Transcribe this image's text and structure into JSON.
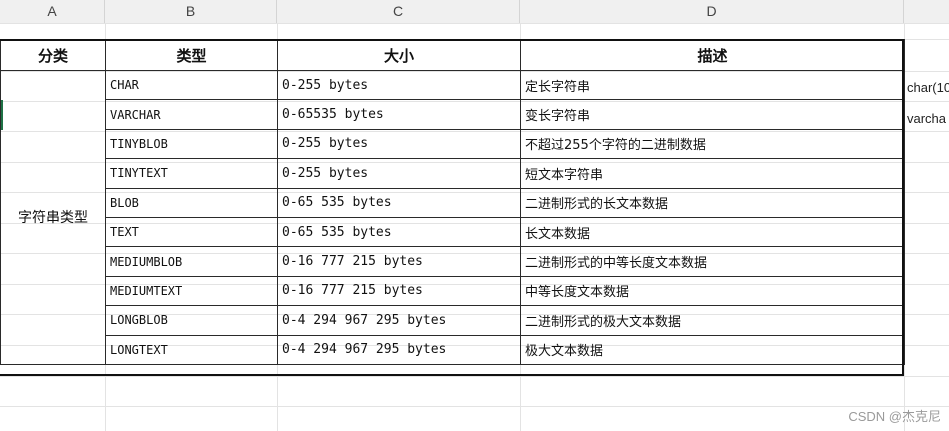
{
  "columns": [
    "A",
    "B",
    "C",
    "D"
  ],
  "table": {
    "headers": [
      "分类",
      "类型",
      "大小",
      "描述"
    ],
    "category": "字符串类型",
    "rows": [
      {
        "type": "CHAR",
        "size": "0-255 bytes",
        "desc": "定长字符串"
      },
      {
        "type": "VARCHAR",
        "size": "0-65535 bytes",
        "desc": "变长字符串"
      },
      {
        "type": "TINYBLOB",
        "size": "0-255 bytes",
        "desc": "不超过255个字符的二进制数据"
      },
      {
        "type": "TINYTEXT",
        "size": "0-255 bytes",
        "desc": "短文本字符串"
      },
      {
        "type": "BLOB",
        "size": "0-65 535 bytes",
        "desc": "二进制形式的长文本数据"
      },
      {
        "type": "TEXT",
        "size": "0-65 535 bytes",
        "desc": "长文本数据"
      },
      {
        "type": "MEDIUMBLOB",
        "size": "0-16 777 215 bytes",
        "desc": "二进制形式的中等长度文本数据"
      },
      {
        "type": "MEDIUMTEXT",
        "size": "0-16 777 215 bytes",
        "desc": "中等长度文本数据"
      },
      {
        "type": "LONGBLOB",
        "size": "0-4 294 967 295 bytes",
        "desc": "二进制形式的极大文本数据"
      },
      {
        "type": "LONGTEXT",
        "size": "0-4 294 967 295 bytes",
        "desc": "极大文本数据"
      }
    ]
  },
  "side_notes": [
    "char(10",
    "varcha"
  ],
  "watermark": "CSDN @杰克尼"
}
